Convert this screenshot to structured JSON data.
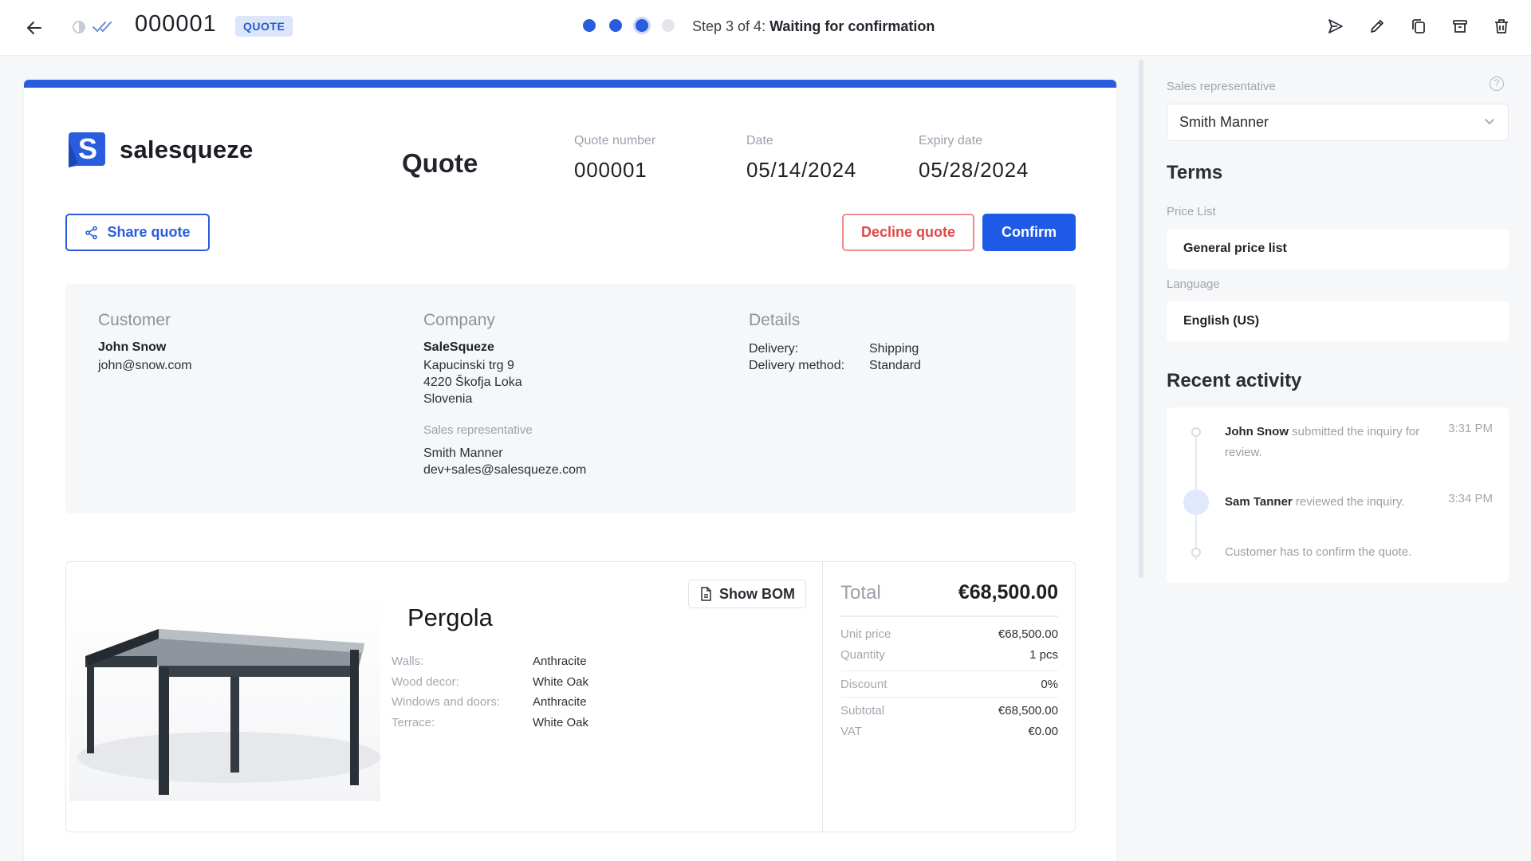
{
  "header": {
    "back_icon": "arrow-left-icon",
    "status_icons": [
      "half-circle-icon",
      "double-check-icon"
    ],
    "document_number": "000001",
    "document_badge": "QUOTE",
    "step_prefix": "Step 3 of 4:",
    "step_label": "Waiting for confirmation",
    "steps_total": 4,
    "steps_done": 3,
    "toolbar_icons": [
      "send-icon",
      "pencil-icon",
      "copy-icon",
      "archive-icon",
      "trash-icon"
    ]
  },
  "quote": {
    "brand": "salesqueze",
    "logo_letter": "S",
    "title": "Quote",
    "number_label": "Quote number",
    "number": "000001",
    "date_label": "Date",
    "date": "05/14/2024",
    "expiry_label": "Expiry date",
    "expiry": "05/28/2024",
    "share_label": "Share quote",
    "decline_label": "Decline quote",
    "confirm_label": "Confirm"
  },
  "customer": {
    "heading": "Customer",
    "name": "John Snow",
    "email": "john@snow.com"
  },
  "company": {
    "heading": "Company",
    "name": "SaleSqueze",
    "address_line1": "Kapucinski trg 9",
    "address_line2": "4220 Škofja Loka",
    "country": "Slovenia",
    "rep_label": "Sales representative",
    "rep_name": "Smith Manner",
    "rep_email": "dev+sales@salesqueze.com"
  },
  "details": {
    "heading": "Details",
    "rows": [
      {
        "key": "Delivery:",
        "value": "Shipping"
      },
      {
        "key": "Delivery method:",
        "value": "Standard"
      }
    ]
  },
  "product": {
    "name": "Pergola",
    "bom_label": "Show BOM",
    "options": [
      {
        "key": "Walls:",
        "value": "Anthracite"
      },
      {
        "key": "Wood decor:",
        "value": "White Oak"
      },
      {
        "key": "Windows and doors:",
        "value": "Anthracite"
      },
      {
        "key": "Terrace:",
        "value": "White Oak"
      }
    ],
    "total_label": "Total",
    "total_value": "€68,500.00",
    "unit_price_label": "Unit price",
    "unit_price": "€68,500.00",
    "quantity_label": "Quantity",
    "quantity": "1 pcs",
    "discount_label": "Discount",
    "discount": "0%",
    "subtotal_label": "Subtotal",
    "subtotal": "€68,500.00",
    "vat_label": "VAT",
    "vat": "€0.00"
  },
  "side": {
    "rep_label": "Sales representative",
    "rep_value": "Smith Manner",
    "help_glyph": "?",
    "terms_heading": "Terms",
    "price_list_label": "Price List",
    "price_list_value": "General price list",
    "language_label": "Language",
    "language_value": "English (US)",
    "activity_heading": "Recent activity",
    "activity": [
      {
        "actor": "John Snow",
        "text": " submitted the inquiry for review.",
        "time": "3:31 PM"
      },
      {
        "actor": "Sam Tanner",
        "text": " reviewed the inquiry.",
        "time": "3:34 PM"
      },
      {
        "actor": "",
        "text": "Customer has to confirm the quote.",
        "time": ""
      }
    ]
  },
  "colors": {
    "accent": "#2a5ddd",
    "confirm_bg": "#1f5ae6",
    "decline": "#e04848",
    "badge_bg": "#dbe6fb",
    "page_bg": "#f6f7f9"
  }
}
